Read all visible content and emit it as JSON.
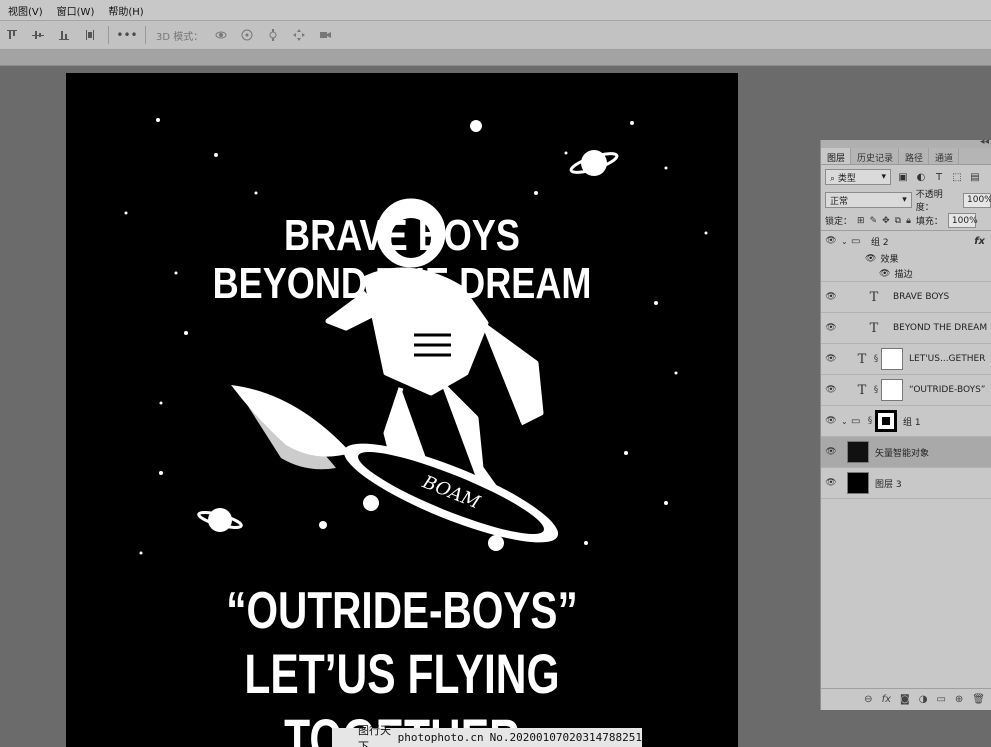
{
  "menu": {
    "items": [
      "视图(V)",
      "窗口(W)",
      "帮助(H)"
    ]
  },
  "options": {
    "mode3d_label": "3D 模式："
  },
  "poster": {
    "line1": "BRAVE BOYS",
    "line2": "BEYOND THE DREAM",
    "line3": "“OUTRIDE-BOYS”",
    "line4": "LET’US FLYING TOGETHER",
    "board_text": "BOAM"
  },
  "watermark": {
    "site": "图行天下",
    "url": "photophoto.cn",
    "code": "No.20200107020314788251"
  },
  "layers_panel": {
    "tabs": [
      "图层",
      "历史记录",
      "路径",
      "通道"
    ],
    "filter_kind": "类型",
    "blend_mode": "正常",
    "opacity_label": "不透明度：",
    "opacity_value": "100%",
    "lock_label": "锁定：",
    "fill_label": "填充：",
    "fill_value": "100%",
    "group2_name": "组 2",
    "effects_label": "效果",
    "stroke_label": "描边",
    "fx_label": "fx",
    "layers": [
      {
        "name": "BRAVE BOYS",
        "kind": "text"
      },
      {
        "name": "BEYOND THE DREAM",
        "kind": "text"
      },
      {
        "name": "LET'US...GETHER",
        "kind": "text-masked"
      },
      {
        "name": "“OUTRIDE-BOYS”",
        "kind": "text-masked"
      },
      {
        "name": "组 1",
        "kind": "group-masked"
      },
      {
        "name": "矢量智能对象",
        "kind": "smart-object",
        "selected": true
      },
      {
        "name": "图层 3",
        "kind": "pixel"
      }
    ]
  }
}
